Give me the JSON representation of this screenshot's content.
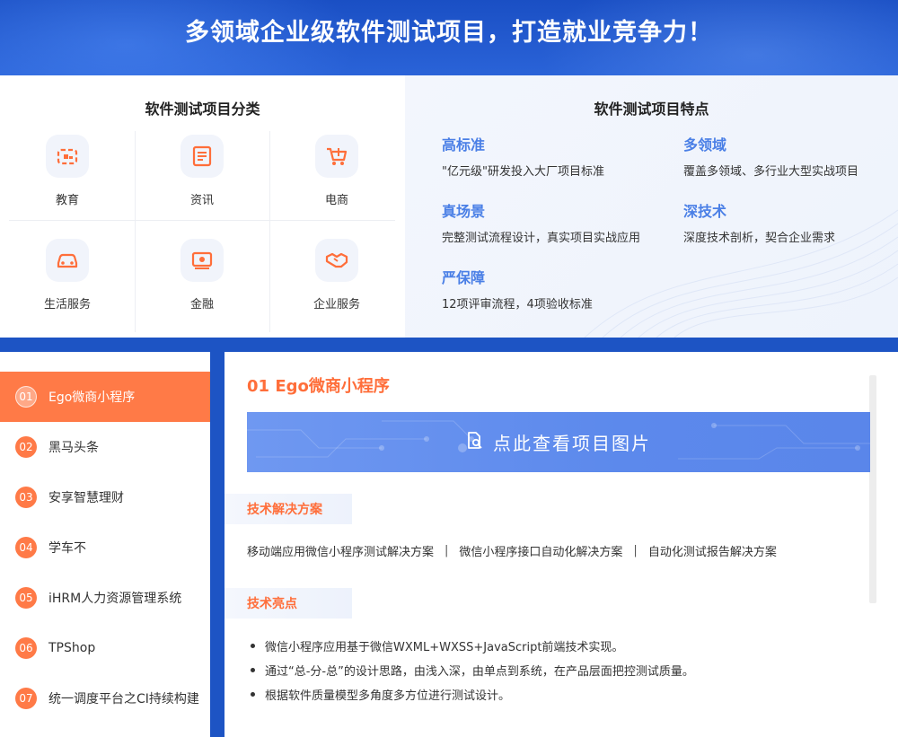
{
  "banner": {
    "title": "多领域企业级软件测试项目，打造就业竞争力！"
  },
  "categories": {
    "title": "软件测试项目分类",
    "items": [
      {
        "label": "教育",
        "icon": "education-icon"
      },
      {
        "label": "资讯",
        "icon": "news-icon"
      },
      {
        "label": "电商",
        "icon": "shopping-cart-icon"
      },
      {
        "label": "生活服务",
        "icon": "car-icon"
      },
      {
        "label": "金融",
        "icon": "money-icon"
      },
      {
        "label": "企业服务",
        "icon": "handshake-icon"
      }
    ]
  },
  "features": {
    "title": "软件测试项目特点",
    "items": [
      {
        "title": "高标准",
        "desc": "\"亿元级\"研发投入大厂项目标准"
      },
      {
        "title": "多领域",
        "desc": "覆盖多领域、多行业大型实战项目"
      },
      {
        "title": "真场景",
        "desc": "完整测试流程设计，真实项目实战应用"
      },
      {
        "title": "深技术",
        "desc": "深度技术剖析，契合企业需求"
      },
      {
        "title": "严保障",
        "desc": "12项评审流程，4项验收标准"
      }
    ]
  },
  "sidebar": {
    "items": [
      {
        "num": "01",
        "label": "Ego微商小程序",
        "active": true
      },
      {
        "num": "02",
        "label": "黑马头条"
      },
      {
        "num": "03",
        "label": "安享智慧理财"
      },
      {
        "num": "04",
        "label": "学车不"
      },
      {
        "num": "05",
        "label": "iHRM人力资源管理系统"
      },
      {
        "num": "06",
        "label": "TPShop"
      },
      {
        "num": "07",
        "label": "统一调度平台之CI持续构建"
      }
    ]
  },
  "project": {
    "title": "01 Ego微商小程序",
    "view_label": "点此查看项目图片",
    "solutions_title": "技术解决方案",
    "solutions": [
      "移动端应用微信小程序测试解决方案",
      "微信小程序接口自动化解决方案",
      "自动化测试报告解决方案"
    ],
    "separator": "|",
    "highlights_title": "技术亮点",
    "highlights": [
      "微信小程序应用基于微信WXML+WXSS+JavaScript前端技术实现。",
      "通过“总-分-总”的设计思路，由浅入深，由单点到系统，在产品层面把控测试质量。",
      "根据软件质量模型多角度多方位进行测试设计。"
    ]
  },
  "colors": {
    "brand_blue": "#1d54c4",
    "accent_orange": "#ff7a47",
    "feature_blue": "#4a7fe6",
    "view_banner_blue": "#5c89ec"
  }
}
